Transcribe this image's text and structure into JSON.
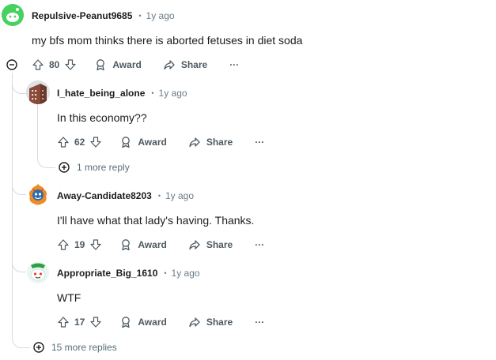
{
  "comments": [
    {
      "author": "Repulsive-Peanut9685",
      "time": "1y ago",
      "text": "my bfs mom thinks there is aborted fetuses in diet soda",
      "votes": "80",
      "award_label": "Award",
      "share_label": "Share",
      "more_label": "···"
    },
    {
      "author": "I_hate_being_alone",
      "time": "1y ago",
      "text": "In this economy??",
      "votes": "62",
      "award_label": "Award",
      "share_label": "Share",
      "more_label": "···",
      "replies_label": "1 more reply"
    },
    {
      "author": "Away-Candidate8203",
      "time": "1y ago",
      "text": "I'll have what that lady's having. Thanks.",
      "votes": "19",
      "award_label": "Award",
      "share_label": "Share",
      "more_label": "···"
    },
    {
      "author": "Appropriate_Big_1610",
      "time": "1y ago",
      "text": "WTF",
      "votes": "17",
      "award_label": "Award",
      "share_label": "Share",
      "more_label": "···"
    }
  ],
  "thread": {
    "more_replies_label": "15 more replies"
  },
  "colors": {
    "thread_line": "#d6dbdf",
    "meta_gray": "#6b7b86",
    "snoo_green": "#46d160"
  }
}
